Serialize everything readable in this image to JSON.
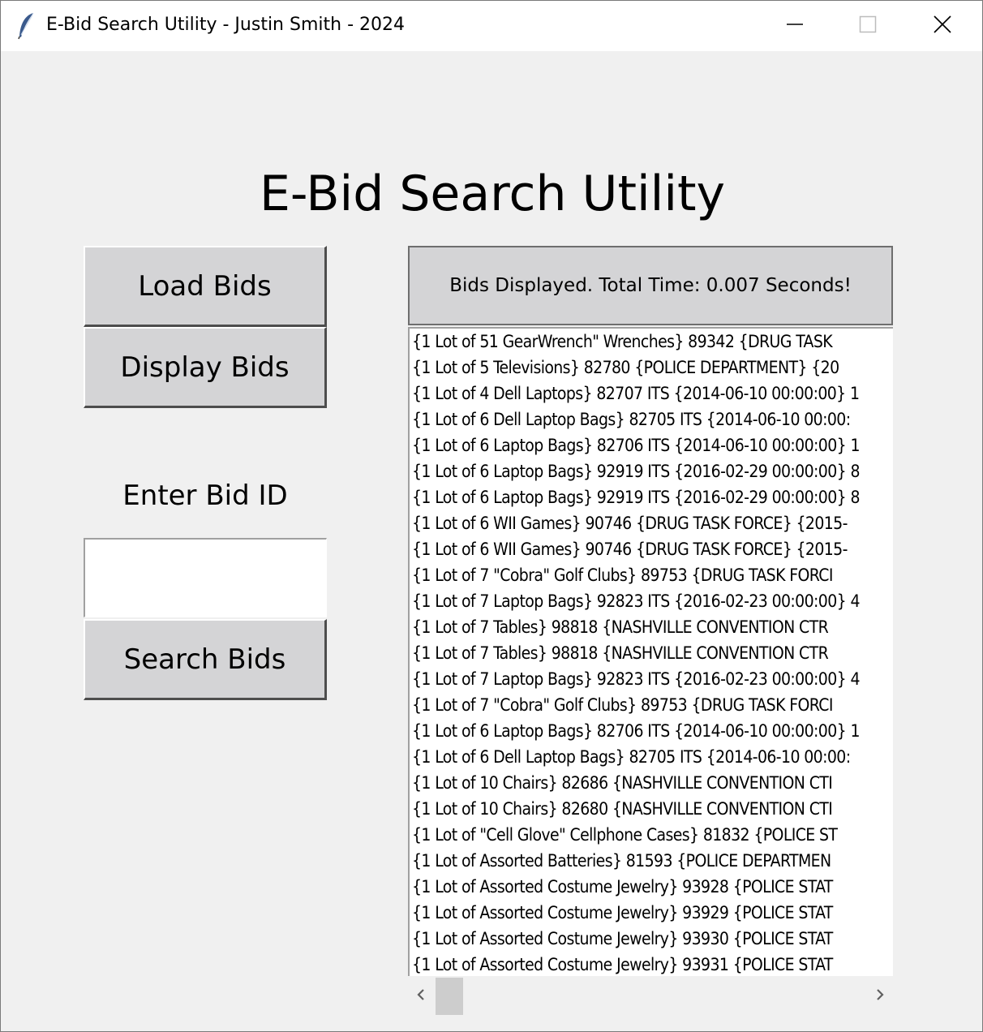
{
  "window": {
    "title": "E-Bid Search Utility - Justin Smith - 2024",
    "icon": "feather-icon",
    "controls": [
      "minimize-icon",
      "maximize-icon",
      "close-icon"
    ]
  },
  "heading": "E-Bid Search Utility",
  "buttons": {
    "load": "Load Bids",
    "display": "Display Bids",
    "search": "Search Bids"
  },
  "search": {
    "label": "Enter Bid ID",
    "value": ""
  },
  "status": "Bids Displayed. Total Time: 0.007 Seconds!",
  "bids": [
    "{1 Lot of 51 GearWrench\" Wrenches} 89342 {DRUG TASK",
    "{1 Lot of 5 Televisions} 82780 {POLICE DEPARTMENT} {20",
    "{1 Lot of 4 Dell Laptops} 82707 ITS {2014-06-10 00:00:00} 1",
    "{1 Lot of 6 Dell Laptop Bags} 82705 ITS {2014-06-10 00:00:",
    "{1 Lot of 6 Laptop Bags} 82706 ITS {2014-06-10 00:00:00} 1",
    "{1 Lot of 6 Laptop Bags} 92919 ITS {2016-02-29 00:00:00} 8",
    "{1 Lot of 6 Laptop Bags} 92919 ITS {2016-02-29 00:00:00} 8",
    "{1 Lot of 6 WII Games} 90746 {DRUG TASK FORCE} {2015-",
    "{1 Lot of 6 WII Games} 90746 {DRUG TASK FORCE} {2015-",
    "{1 Lot of 7 \"Cobra\" Golf Clubs} 89753 {DRUG TASK FORCI",
    "{1 Lot of 7 Laptop Bags} 92823 ITS {2016-02-23 00:00:00} 4",
    "{1 Lot of 7 Tables} 98818 {NASHVILLE CONVENTION CTR",
    "{1 Lot of 7 Tables} 98818 {NASHVILLE CONVENTION CTR",
    "{1 Lot of 7 Laptop Bags} 92823 ITS {2016-02-23 00:00:00} 4",
    "{1 Lot of 7 \"Cobra\" Golf Clubs} 89753 {DRUG TASK FORCI",
    "{1 Lot of 6 Laptop Bags} 82706 ITS {2014-06-10 00:00:00} 1",
    "{1 Lot of 6 Dell Laptop Bags} 82705 ITS {2014-06-10 00:00:",
    "{1 Lot of 10 Chairs} 82686 {NASHVILLE CONVENTION CTI",
    "{1 Lot of 10 Chairs} 82680 {NASHVILLE CONVENTION CTI",
    "{1 Lot of \"Cell Glove\" Cellphone Cases} 81832 {POLICE ST",
    "{1 Lot of Assorted Batteries} 81593 {POLICE DEPARTMEN",
    "{1 Lot of Assorted Costume Jewelry} 93928 {POLICE STAT",
    "{1 Lot of Assorted Costume Jewelry} 93929 {POLICE STAT",
    "{1 Lot of Assorted Costume Jewelry} 93930 {POLICE STAT",
    "{1 Lot of Assorted Costume Jewelry} 93931 {POLICE STAT"
  ],
  "scrollbar": {
    "left_icon": "chevron-left-icon",
    "right_icon": "chevron-right-icon"
  }
}
